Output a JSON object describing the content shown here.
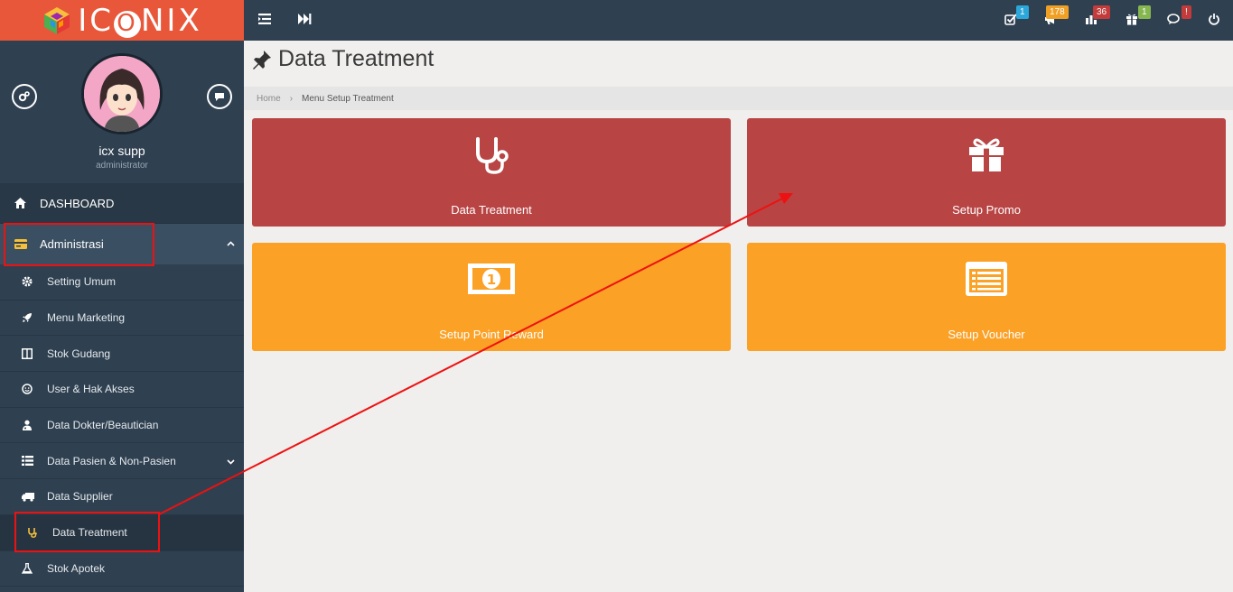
{
  "brand": {
    "name_prefix": "IC",
    "name_o": "O",
    "name_suffix": "NIX"
  },
  "user": {
    "name": "icx supp",
    "role": "administrator"
  },
  "sidebar": {
    "dashboard": "DASHBOARD",
    "section": "Administrasi",
    "items": [
      {
        "label": "Setting Umum",
        "icon": "gear-icon"
      },
      {
        "label": "Menu Marketing",
        "icon": "rocket-icon"
      },
      {
        "label": "Stok Gudang",
        "icon": "columns-icon"
      },
      {
        "label": "User & Hak Akses",
        "icon": "smile-icon"
      },
      {
        "label": "Data Dokter/Beautician",
        "icon": "user-md-icon"
      },
      {
        "label": "Data Pasien & Non-Pasien",
        "icon": "list-icon"
      },
      {
        "label": "Data Supplier",
        "icon": "truck-icon"
      },
      {
        "label": "Data Treatment",
        "icon": "stethoscope-icon"
      },
      {
        "label": "Stok Apotek",
        "icon": "flask-icon"
      }
    ]
  },
  "topbar": {
    "badges": [
      {
        "icon": "tasks-icon",
        "count": "1",
        "color": "#2ba7d9"
      },
      {
        "icon": "bullhorn-icon",
        "count": "178",
        "color": "#f0a024"
      },
      {
        "icon": "chart-icon",
        "count": "36",
        "color": "#c33b3b"
      },
      {
        "icon": "gift-icon",
        "count": "1",
        "color": "#86b64f"
      },
      {
        "icon": "comments-icon",
        "count": "!",
        "color": "#c33b3b"
      }
    ]
  },
  "page": {
    "title": "Data Treatment",
    "breadcrumb_home": "Home",
    "breadcrumb_current": "Menu Setup Treatment"
  },
  "tiles": [
    {
      "label": "Data Treatment",
      "icon": "stethoscope-icon",
      "color": "#b94444"
    },
    {
      "label": "Setup Promo",
      "icon": "gift-icon",
      "color": "#b94444"
    },
    {
      "label": "Setup Point Reward",
      "icon": "money-icon",
      "color": "#fba126"
    },
    {
      "label": "Setup Voucher",
      "icon": "list-alt-icon",
      "color": "#fba126"
    }
  ]
}
